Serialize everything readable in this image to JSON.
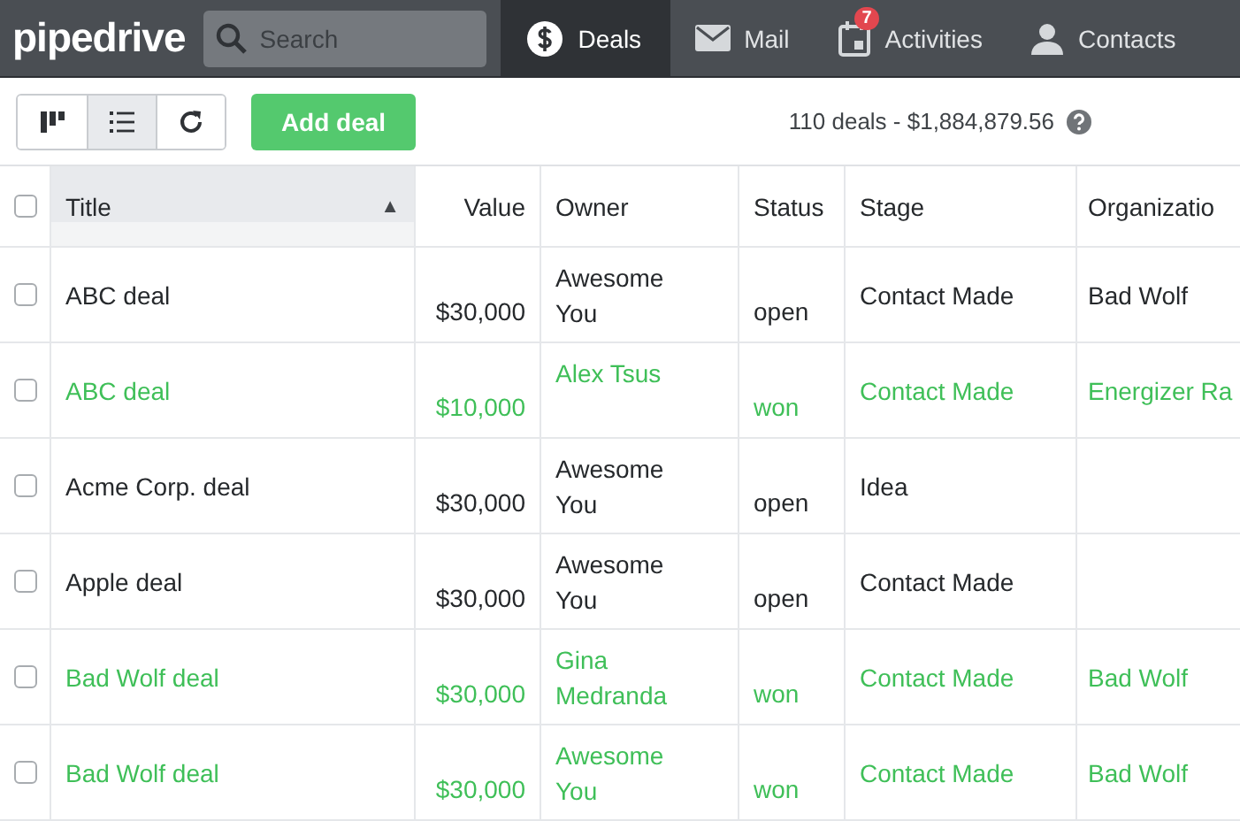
{
  "brand": "pipedrive",
  "search": {
    "placeholder": "Search"
  },
  "nav": [
    {
      "label": "Deals",
      "kind": "dollar",
      "selected": true
    },
    {
      "label": "Mail",
      "kind": "mail",
      "selected": false
    },
    {
      "label": "Activities",
      "kind": "calendar",
      "selected": false,
      "badge": "7"
    },
    {
      "label": "Contacts",
      "kind": "person",
      "selected": false
    }
  ],
  "views": [
    {
      "kind": "pipeline",
      "selected": false
    },
    {
      "kind": "list",
      "selected": true
    },
    {
      "kind": "refresh",
      "selected": false
    }
  ],
  "select_all_checked": false,
  "add_button": "Add deal",
  "summary": "110 deals - $1,884,879.56",
  "table": {
    "columns": [
      {
        "label": "Title",
        "sorted": true,
        "sort_icon": "▲"
      },
      {
        "label": "Value"
      },
      {
        "label": "Owner"
      },
      {
        "label": "Status"
      },
      {
        "label": "Stage"
      },
      {
        "label": "Organizatio"
      }
    ],
    "rows": [
      {
        "title": "ABC deal",
        "value": "$30,000",
        "owner": "Awesome You",
        "status": "open",
        "stage": "Contact Made",
        "organization": "Bad Wolf",
        "won": false,
        "checked": false
      },
      {
        "title": "ABC deal",
        "value": "$10,000",
        "owner": "Alex Tsus",
        "status": "won",
        "stage": "Contact Made",
        "organization": "Energizer Ra",
        "won": true,
        "checked": false
      },
      {
        "title": "Acme Corp. deal",
        "value": "$30,000",
        "owner": "Awesome You",
        "status": "open",
        "stage": "Idea",
        "won": false,
        "checked": false
      },
      {
        "title": "Apple deal",
        "value": "$30,000",
        "owner": "Awesome You",
        "status": "open",
        "stage": "Contact Made",
        "won": false,
        "checked": false
      },
      {
        "title": "Bad Wolf deal",
        "value": "$30,000",
        "owner": "Gina Medranda",
        "status": "won",
        "stage": "Contact Made",
        "organization": "Bad Wolf",
        "won": true,
        "checked": false
      },
      {
        "title": "Bad Wolf deal",
        "value": "$30,000",
        "owner": "Awesome You",
        "status": "won",
        "stage": "Contact Made",
        "organization": "Bad Wolf",
        "won": true,
        "checked": false
      }
    ]
  }
}
